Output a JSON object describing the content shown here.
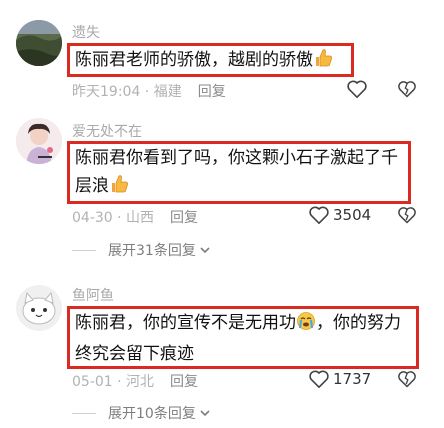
{
  "comments": [
    {
      "username": "遗失",
      "text": "陈丽君老师的骄傲，越剧的骄傲",
      "emoji": "thumbs-up",
      "time": "昨天19:04",
      "location": "福建",
      "reply_label": "回复",
      "likes": ""
    },
    {
      "username": "爱无处不在",
      "text": "陈丽君你看到了吗，你这颗小石子激起了千层浪",
      "emoji": "thumbs-up",
      "time": "04-30",
      "location": "山西",
      "reply_label": "回复",
      "likes": "3504",
      "expand_label": "展开31条回复"
    },
    {
      "username": "鱼阿鱼",
      "text_part1": "陈丽君，你的宣传不是无用功",
      "emoji": "crying-face",
      "text_part2": "，你的努力终究会留下痕迹",
      "time": "05-01",
      "location": "河北",
      "reply_label": "回复",
      "likes": "1737",
      "expand_label": "展开10条回复"
    }
  ],
  "colors": {
    "highlight_border": "#d92b22",
    "meta_gray": "#b2b2b2"
  }
}
